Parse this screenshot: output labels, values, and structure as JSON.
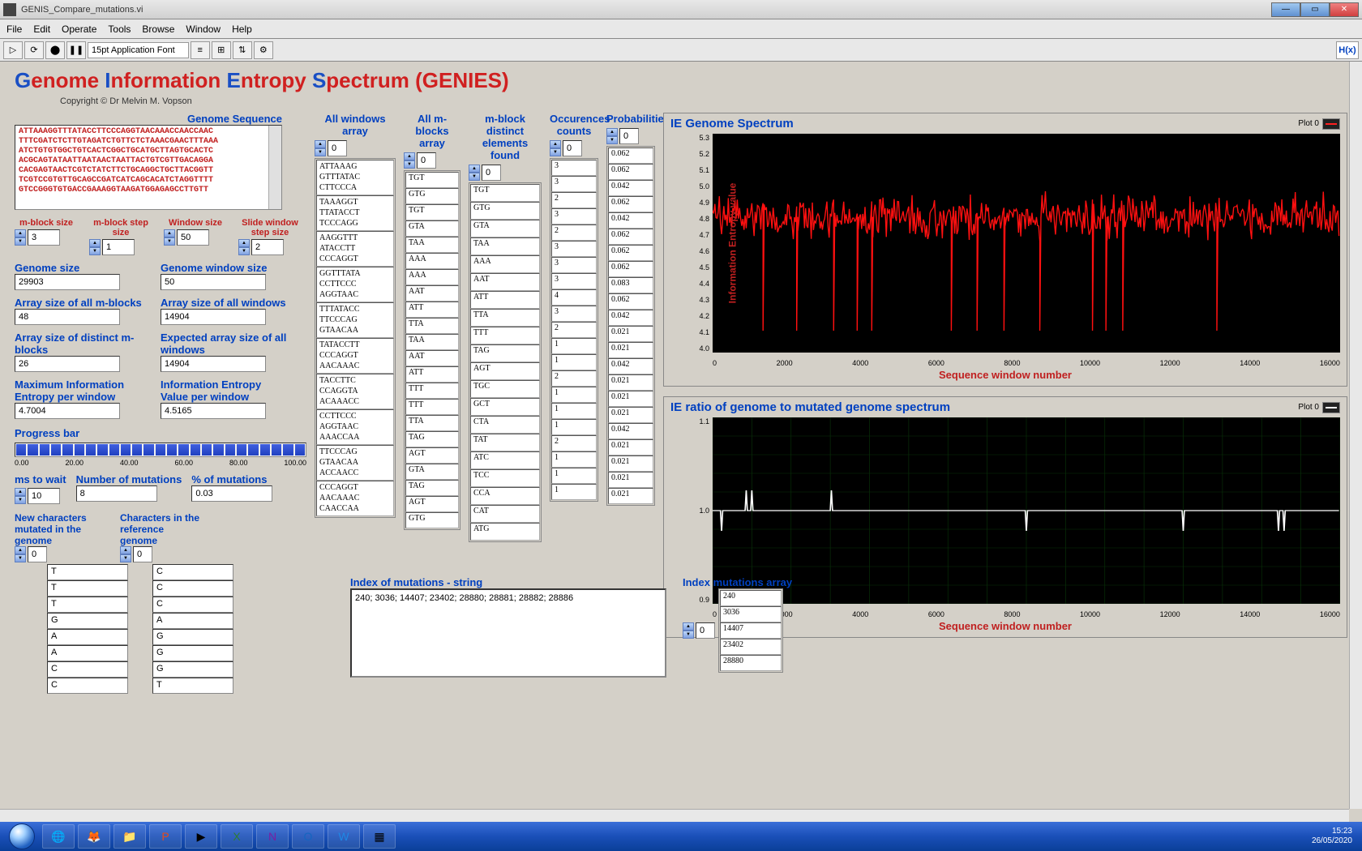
{
  "window": {
    "title": "GENIS_Compare_mutations.vi"
  },
  "menu": [
    "File",
    "Edit",
    "Operate",
    "Tools",
    "Browse",
    "Window",
    "Help"
  ],
  "toolbar": {
    "font": "15pt Application Font",
    "hvi": "H(x)"
  },
  "app": {
    "title_parts": [
      "G",
      "enome ",
      "I",
      "nformation ",
      "E",
      "ntropy ",
      "S",
      "pectrum (GENIES)"
    ],
    "copyright": "Copyright © Dr Melvin M. Vopson"
  },
  "sequence": {
    "label": "Genome Sequence",
    "lines": [
      "ATTAAAGGTTTATACCTTCCCAGGTAACAAACCAACCAAC",
      "TTTCGATCTCTTGTAGATCTGTTCTCTAAACGAACTTTAAA",
      "ATCTGTGTGGCTGTCACTCGGCTGCATGCTTAGTGCACTC",
      "ACGCAGTATAATTAATAACTAATTACTGTCGTTGACAGGA",
      "CACGAGTAACTCGTCTATCTTCTGCAGGCTGCTTACGGTT",
      "TCGTCCGTGTTGCAGCCGATCATCAGCACATCTAGGTTTT",
      "GTCCGGGTGTGACCGAAAGGTAAGATGGAGAGCCTTGTT"
    ]
  },
  "params": {
    "mblock_size": {
      "label": "m-block size",
      "value": "3"
    },
    "mblock_step": {
      "label": "m-block step size",
      "value": "1"
    },
    "window_size": {
      "label": "Window size",
      "value": "50"
    },
    "slide_step": {
      "label": "Slide window step size",
      "value": "2"
    }
  },
  "stats": {
    "genome_size": {
      "label": "Genome size",
      "value": "29903"
    },
    "genome_window_size": {
      "label": "Genome window size",
      "value": "50"
    },
    "arr_mblocks": {
      "label": "Array size of all m-blocks",
      "value": "48"
    },
    "arr_windows": {
      "label": "Array size of all windows",
      "value": "14904"
    },
    "distinct_mblocks": {
      "label": "Array size of distinct m-blocks",
      "value": "26"
    },
    "expected_windows": {
      "label": "Expected array size of all windows",
      "value": "14904"
    },
    "max_entropy": {
      "label": "Maximum Information Entropy per window",
      "value": "4.7004"
    },
    "entropy_per_window": {
      "label": "Information Entropy Value per window",
      "value": "4.5165"
    }
  },
  "progress": {
    "label": "Progress bar",
    "ticks": [
      "0.00",
      "20.00",
      "40.00",
      "60.00",
      "80.00",
      "100.00"
    ]
  },
  "bottom_params": {
    "ms_wait": {
      "label": "ms to wait",
      "value": "10"
    },
    "num_mut": {
      "label": "Number of mutations",
      "value": "8"
    },
    "pct_mut": {
      "label": "% of mutations",
      "value": "0.03"
    }
  },
  "char_arrays": {
    "new_chars": {
      "label": "New characters mutated in the genome",
      "index": "0",
      "items": [
        "T",
        "T",
        "T",
        "G",
        "A",
        "A",
        "C",
        "C"
      ]
    },
    "ref_chars": {
      "label": "Characters in the reference genome",
      "index": "0",
      "items": [
        "C",
        "C",
        "C",
        "A",
        "G",
        "G",
        "G",
        "T"
      ]
    }
  },
  "arrays": {
    "windows": {
      "label": "All windows array",
      "index": "0",
      "items": [
        "ATTAAAG\nGTTTATAC\nCTTCCCA",
        "TAAAGGT\nTTATACCT\nTCCCAGG",
        "AAGGTTT\nATACCTT\nCCCAGGT",
        "GGTTTATA\nCCTTCCC\nAGGTAAC",
        "TTTATACC\nTTCCCAG\nGTAACAA",
        "TATACCTT\nCCCAGGT\nAACAAAC",
        "TACCTTC\nCCAGGTA\nACAAACC",
        "CCTTCCC\nAGGTAAC\nAAACCAA",
        "TTCCCAG\nGTAACAA\nACCAACC",
        "CCCAGGT\nAACAAAC\nCAACCAA"
      ]
    },
    "mblocks": {
      "label": "All m-blocks array",
      "index": "0",
      "items": [
        "TGT",
        "GTG",
        "TGT",
        "GTA",
        "TAA",
        "AAA",
        "AAA",
        "AAT",
        "ATT",
        "TTA",
        "TAA",
        "AAT",
        "ATT",
        "TTT",
        "TTT",
        "TTA",
        "TAG",
        "AGT",
        "GTA",
        "TAG",
        "AGT",
        "GTG"
      ]
    },
    "distinct": {
      "label": "m-block distinct elements found",
      "index": "0",
      "items": [
        "TGT",
        "GTG",
        "GTA",
        "TAA",
        "AAA",
        "AAT",
        "ATT",
        "TTA",
        "TTT",
        "TAG",
        "AGT",
        "TGC",
        "GCT",
        "CTA",
        "TAT",
        "ATC",
        "TCC",
        "CCA",
        "CAT",
        "ATG"
      ]
    },
    "occurences": {
      "label": "Occurences counts",
      "index": "0",
      "items": [
        "3",
        "3",
        "2",
        "3",
        "2",
        "3",
        "3",
        "3",
        "4",
        "3",
        "2",
        "1",
        "1",
        "2",
        "1",
        "1",
        "1",
        "2",
        "1",
        "1",
        "1"
      ]
    },
    "probabilities": {
      "label": "Probabilities",
      "index": "0",
      "items": [
        "0.062",
        "0.062",
        "0.042",
        "0.062",
        "0.042",
        "0.062",
        "0.062",
        "0.062",
        "0.083",
        "0.062",
        "0.042",
        "0.021",
        "0.021",
        "0.042",
        "0.021",
        "0.021",
        "0.021",
        "0.042",
        "0.021",
        "0.021",
        "0.021",
        "0.021"
      ]
    }
  },
  "mutations": {
    "index_label": "Index of mutations - string",
    "index_string": "240; 3036; 14407; 23402; 28880; 28881; 28882; 28886",
    "array_label": "Index mutations array",
    "array_index": "0",
    "array_items": [
      "240",
      "3036",
      "14407",
      "23402",
      "28880"
    ]
  },
  "chart_data": [
    {
      "type": "line",
      "title": "IE Genome Spectrum",
      "xlabel": "Sequence window number",
      "ylabel": "Information Entropy value",
      "xlim": [
        0,
        16000
      ],
      "ylim": [
        4.0,
        5.3
      ],
      "xticks": [
        "0",
        "2000",
        "4000",
        "6000",
        "8000",
        "10000",
        "12000",
        "14000",
        "16000"
      ],
      "yticks": [
        "5.3",
        "5.2",
        "5.1",
        "5.0",
        "4.9",
        "4.8",
        "4.7",
        "4.6",
        "4.5",
        "4.4",
        "4.3",
        "4.2",
        "4.1",
        "4.0"
      ],
      "legend": "Plot 0",
      "note": "dense noisy red series oscillating mostly between ~4.4 and 5.2 across ~14900 windows"
    },
    {
      "type": "line",
      "title": "IE ratio of genome to mutated genome spectrum",
      "xlabel": "Sequence window number",
      "ylabel": "",
      "xlim": [
        0,
        16000
      ],
      "ylim": [
        0.9,
        1.1
      ],
      "xticks": [
        "0",
        "2000",
        "4000",
        "6000",
        "8000",
        "10000",
        "12000",
        "14000",
        "16000"
      ],
      "yticks": [
        "1.1",
        "1.0",
        "0.9"
      ],
      "legend": "Plot 0",
      "note": "flat white line at 1.0 with small spikes near x≈240, 900, 3036, 8000, 12000, 14400"
    }
  ],
  "taskbar": {
    "time": "15:23",
    "date": "26/05/2020"
  }
}
